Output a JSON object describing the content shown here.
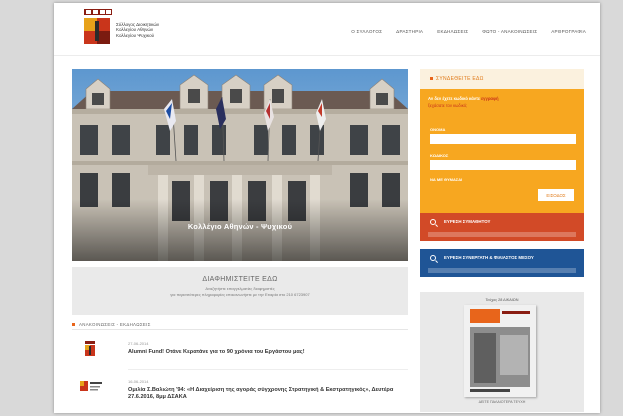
{
  "header": {
    "logo_lines": [
      "Σύλλογος Διοικητικών",
      "Κολλεγίου Αθηνών",
      "Κολλεγίου Ψυχικού"
    ],
    "nav": [
      "Ο ΣΥΛΛΟΓΟΣ",
      "ΔΡΑΣΤΗΡΙΑ",
      "ΕΚΔΗΛΩΣΕΙΣ",
      "ΦΩΤΟ - ΑΝΑΚΟΙΝΩΣΕΙΣ",
      "ΑΡΘΡΟΓΡΑΦΙΑ"
    ]
  },
  "hero": {
    "caption": "Κολλέγιο Αθηνών - Ψυχικού"
  },
  "announce": {
    "title": "ΔΙΑΦΗΜΙΣΤΕΙΤΕ ΕΔΩ",
    "sub1": "Αναζητήστε επαγγελματίες διαφημιστές",
    "sub2": "για περισσότερες πληροφορίες επικοινωνήστε με την Εταιρία στο 210 6723907"
  },
  "news": {
    "heading": "ΑΝΑΚΟΙΝΩΣΕΙΣ - ΕΚΔΗΛΩΣΕΙΣ",
    "items": [
      {
        "date": "27-06-2014",
        "title": "Alumni Fund! Οτάνε Κερατάνε για το 90 χρόνια του Εργάστου μας!"
      },
      {
        "date": "16-06-2014",
        "title": "Ομιλία Σ.Βαλιώτη '94: «Η Διαχείριση της αγοράς σύγχρονης Στρατηγική & Εκστρατηγικός», Δευτέρα 27.6.2016, 8μμ ΔΣΑΚΑ"
      }
    ]
  },
  "login": {
    "heading": "ΣΥΝΔΕΘΕΙΤΕ ΕΔΩ",
    "line1": "Αν δεν έχετε κωδικό κάντε",
    "line1_link": "εγγραφή",
    "line2": "ξεχάσατε τον κωδικό;",
    "user_label": "ΟΝΟΜΑ",
    "pass_label": "ΚΩΔΙΚΟΣ",
    "remember_label": "ΝΑ ΜΕ ΘΥΜΑΣΑΙ",
    "button": "ΕΙΣΟΔΟΣ"
  },
  "search_grad": {
    "label": "ΕΥΡΕΣΗ ΣΥΜΑΘΗΤΟΥ"
  },
  "search_partner": {
    "label": "ΕΥΡΕΣΗ ΣΥΝΕΡΓΑΤΗ & ΦΙΛΙΑΣΤΟΣ ΜΕΣΟΥ"
  },
  "magazine": {
    "title": "Τεύχος 28 ΔΙΚΑΙΩΝ",
    "bottom": "ΔΕΙΤΕ ΠΑΛΑΙΟΤΕΡΑ ΤΕΥΧΗ"
  },
  "colors": {
    "accent_orange": "#f7a720",
    "search_red": "#d24a27",
    "search_blue": "#1f5596",
    "logo_red": "#c9351b"
  }
}
